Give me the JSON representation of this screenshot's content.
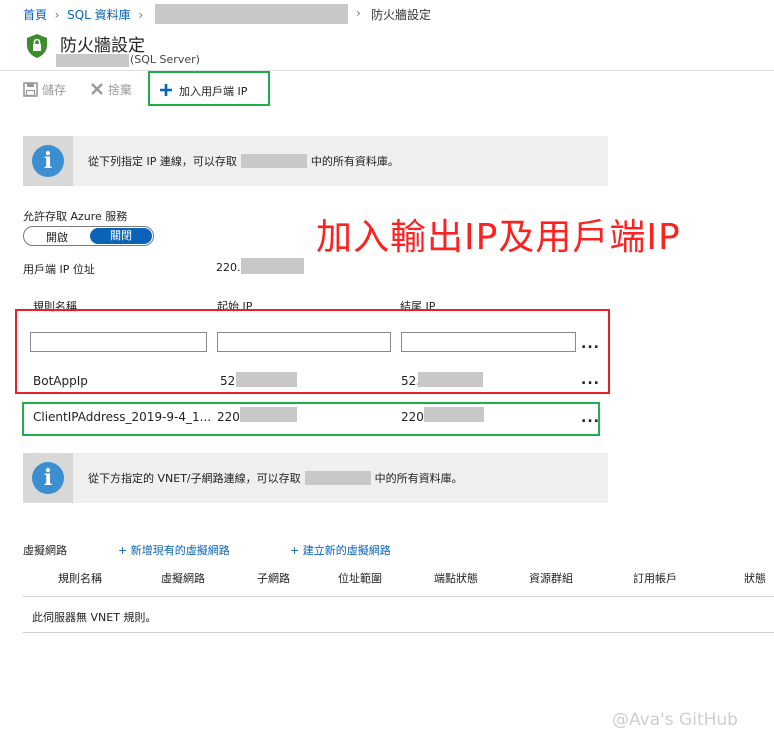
{
  "breadcrumb": {
    "home": "首頁",
    "sql": "SQL 資料庫",
    "current": "防火牆設定"
  },
  "title": {
    "text": "防火牆設定",
    "subtitle": "(SQL Server)"
  },
  "toolbar": {
    "save": "儲存",
    "discard": "捨棄",
    "add_client_ip": "加入用戶端 IP"
  },
  "info1": {
    "text_before": "從下列指定 IP 連線，可以存取",
    "text_after": "中的所有資料庫。"
  },
  "allow_azure": {
    "label": "允許存取 Azure 服務",
    "on": "開啟",
    "off": "關閉",
    "selected": "關閉"
  },
  "client_ip": {
    "label": "用戶端 IP 位址",
    "value": "220."
  },
  "annotation": {
    "text": "加入輸出IP及用戶端IP",
    "color": "#ff2020"
  },
  "rules": {
    "headers": {
      "name": "規則名稱",
      "start": "起始 IP",
      "end": "結尾 IP"
    },
    "inputs": {
      "name": "",
      "start": "",
      "end": ""
    },
    "rows": [
      {
        "name": "BotAppIp",
        "start": "52.",
        "end": "52."
      },
      {
        "name": "ClientIPAddress_2019-9-4_1...",
        "start": "220.",
        "end": "220."
      }
    ],
    "more": "..."
  },
  "info2": {
    "text_before": "從下方指定的 VNET/子網路連線，可以存取",
    "text_after": "中的所有資料庫。"
  },
  "vnet": {
    "label": "虛擬網路",
    "add_existing": "+ 新增現有的虛擬網路",
    "create_new": "+ 建立新的虛擬網路",
    "headers": [
      "規則名稱",
      "虛擬網路",
      "子網路",
      "位址範圍",
      "端點狀態",
      "資源群組",
      "訂用帳戶",
      "狀態"
    ],
    "empty": "此伺服器無 VNET 規則。"
  },
  "watermark": "@Ava's GitHub",
  "colors": {
    "accent": "#0a63b8",
    "red_box": "#e8202a",
    "green_box": "#1fae4a",
    "shield": "#3d8b2f"
  }
}
